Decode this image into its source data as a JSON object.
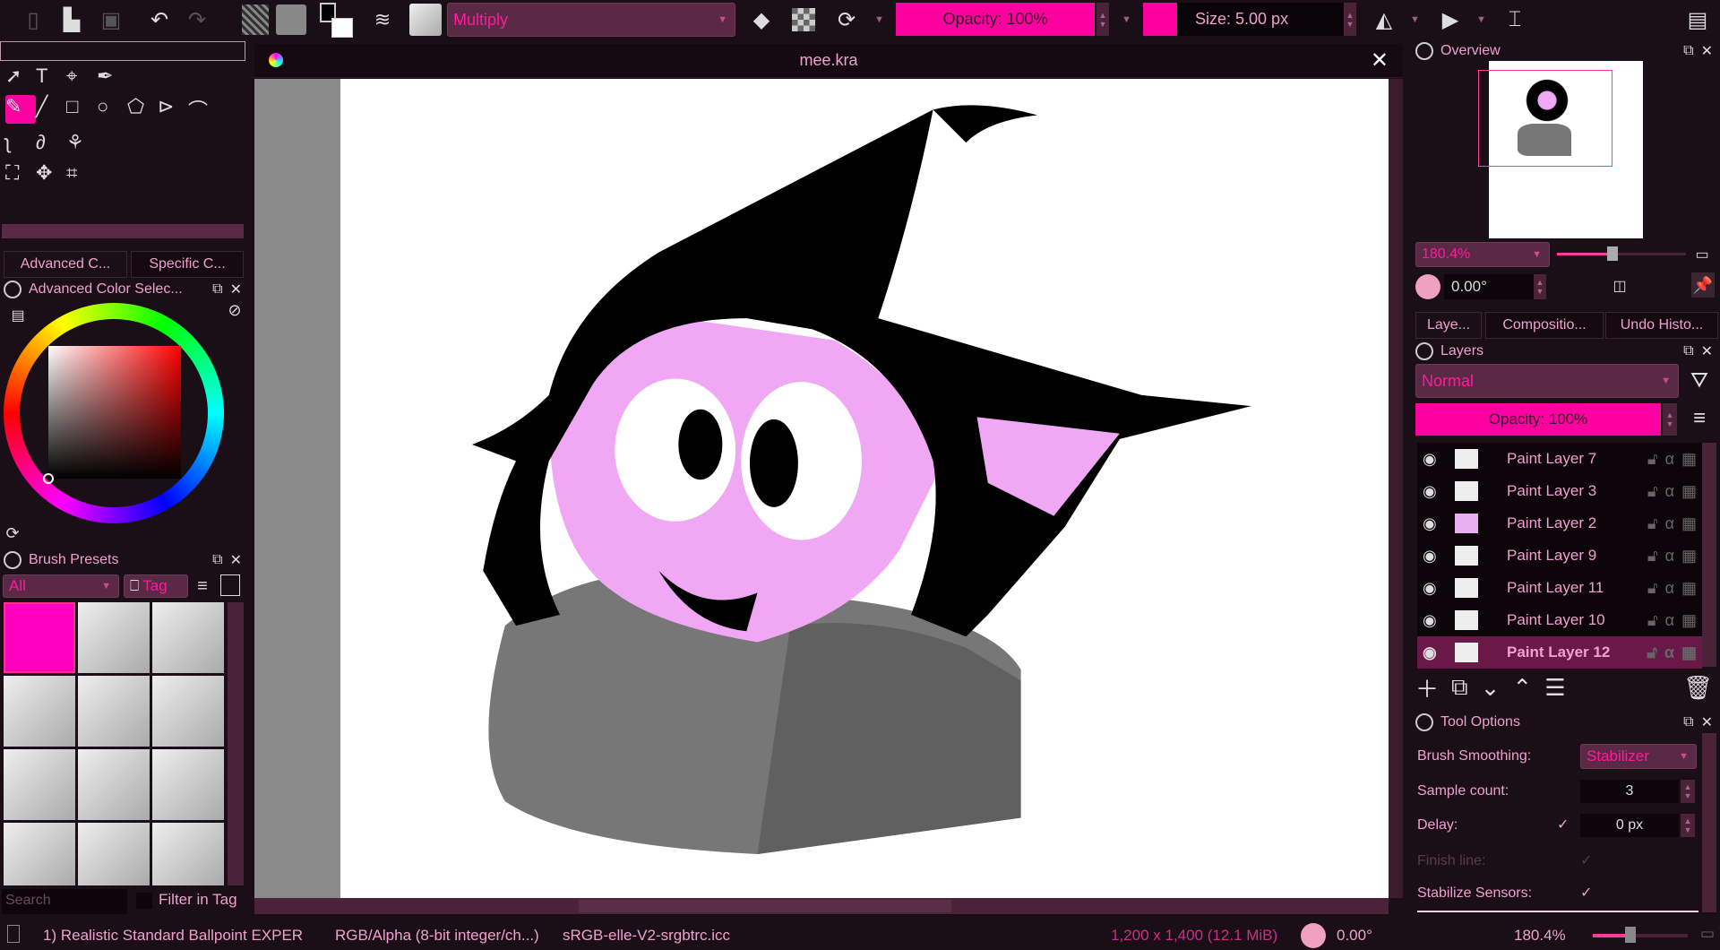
{
  "toolbar": {
    "blend_mode": "Multiply",
    "opacity": "Opacity: 100%",
    "size": "Size: 5.00 px",
    "accent": "#ff00a0"
  },
  "document": {
    "title": "mee.kra"
  },
  "left": {
    "color_tabs": [
      "Advanced C...",
      "Specific C..."
    ],
    "color_panel_title": "Advanced Color Selec...",
    "brush_presets_title": "Brush Presets",
    "brush_filter": "All",
    "tag_label": "Tag",
    "search_placeholder": "Search",
    "filter_in_tag": "Filter in Tag"
  },
  "overview": {
    "title": "Overview",
    "zoom": "180.4%",
    "rotation": "0.00°"
  },
  "right_tabs": [
    "Laye...",
    "Compositio...",
    "Undo Histo..."
  ],
  "layers": {
    "title": "Layers",
    "blend_mode": "Normal",
    "opacity": "Opacity:  100%",
    "items": [
      {
        "name": "Paint Layer 7"
      },
      {
        "name": "Paint Layer 3"
      },
      {
        "name": "Paint Layer 2"
      },
      {
        "name": "Paint Layer 9"
      },
      {
        "name": "Paint Layer 11"
      },
      {
        "name": "Paint Layer 10"
      },
      {
        "name": "Paint Layer 12",
        "selected": true
      }
    ]
  },
  "tool_options": {
    "title": "Tool Options",
    "brush_smoothing_label": "Brush Smoothing:",
    "brush_smoothing": "Stabilizer",
    "sample_count_label": "Sample count:",
    "sample_count": "3",
    "delay_label": "Delay:",
    "delay": "0 px",
    "finish_line_label": "Finish line:",
    "stabilize_sensors_label": "Stabilize Sensors:"
  },
  "status": {
    "brush": "1) Realistic Standard Ballpoint EXPER",
    "color_space": "RGB/Alpha (8-bit integer/ch...)",
    "profile": "sRGB-elle-V2-srgbtrc.icc",
    "dimensions": "1,200 x 1,400 (12.1 MiB)",
    "rotation": "0.00°",
    "zoom": "180.4%"
  }
}
